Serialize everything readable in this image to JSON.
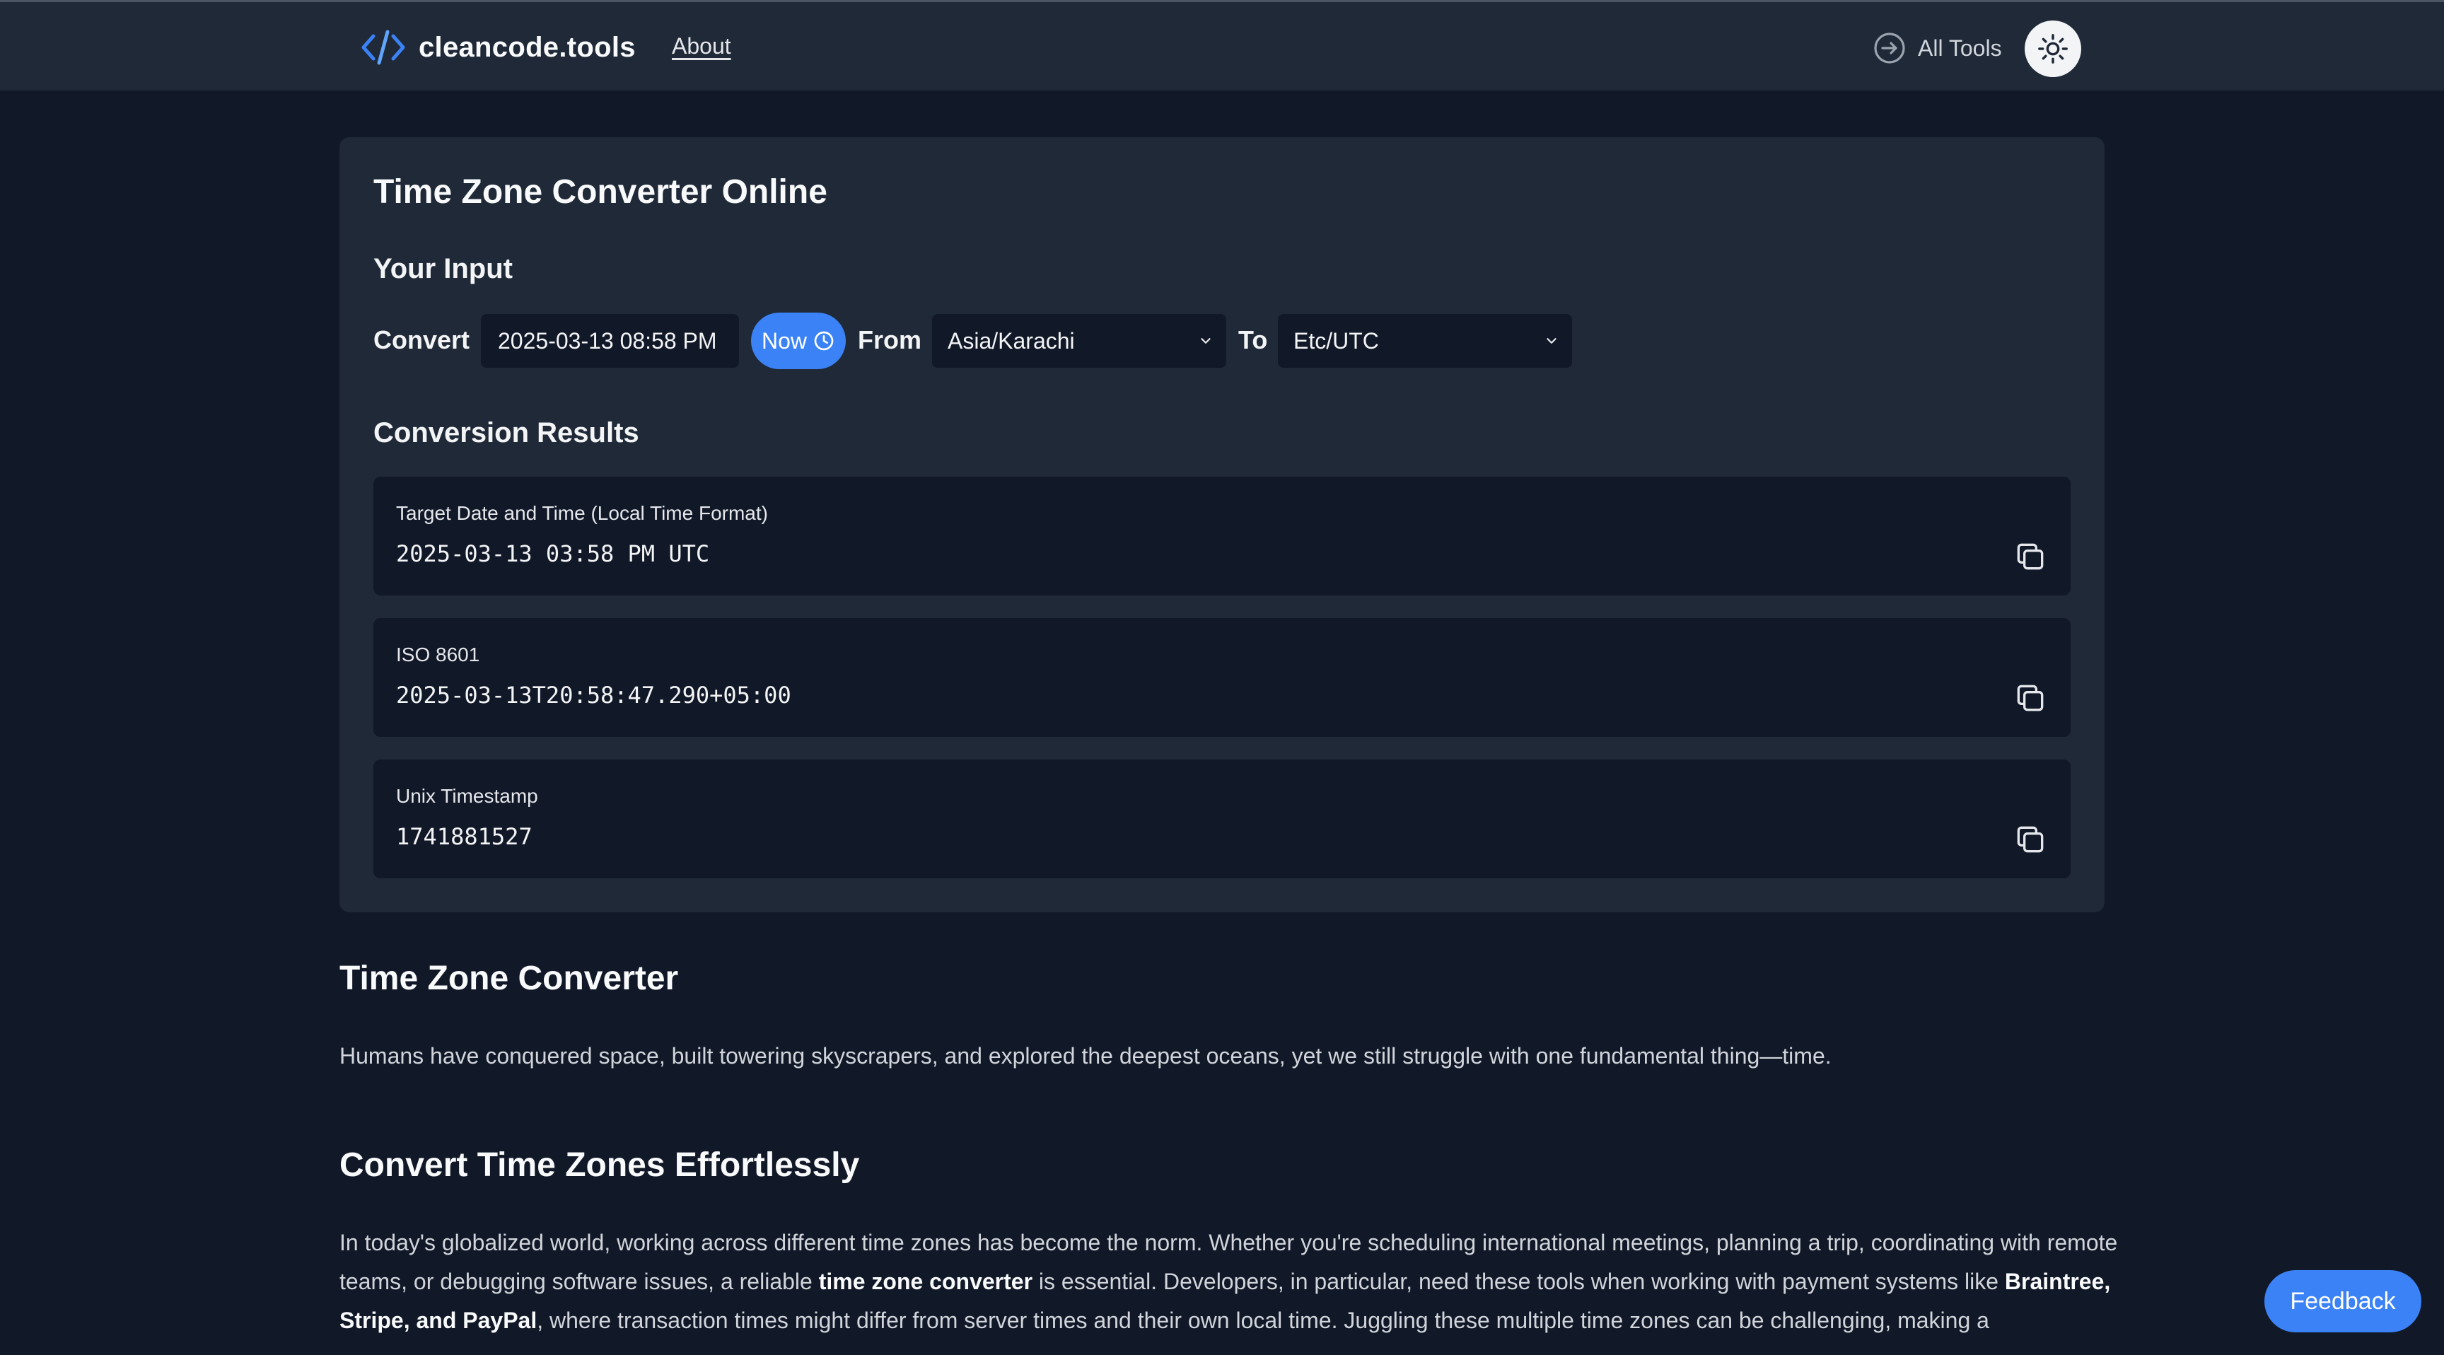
{
  "header": {
    "logo_text": "cleancode.tools",
    "about_label": "About",
    "all_tools_label": "All Tools"
  },
  "converter": {
    "title": "Time Zone Converter Online",
    "input_heading": "Your Input",
    "convert_label": "Convert",
    "datetime_value": "2025-03-13 08:58 PM",
    "now_label": "Now",
    "from_label": "From",
    "from_value": "Asia/Karachi",
    "to_label": "To",
    "to_value": "Etc/UTC",
    "results_heading": "Conversion Results",
    "results": [
      {
        "label": "Target Date and Time (Local Time Format)",
        "value": "2025-03-13 03:58 PM UTC"
      },
      {
        "label": "ISO 8601",
        "value": "2025-03-13T20:58:47.290+05:00"
      },
      {
        "label": "Unix Timestamp",
        "value": "1741881527"
      }
    ]
  },
  "article": {
    "h1": "Time Zone Converter",
    "p1": "Humans have conquered space, built towering skyscrapers, and explored the deepest oceans, yet we still struggle with one fundamental thing—time.",
    "h2": "Convert Time Zones Effortlessly",
    "p2_a": "In today's globalized world, working across different time zones has become the norm. Whether you're scheduling international meetings, planning a trip, coordinating with remote teams, or debugging software issues, a reliable ",
    "p2_b": "time zone converter",
    "p2_c": " is essential. Developers, in particular, need these tools when working with payment systems like ",
    "p2_d": "Braintree, Stripe, and PayPal",
    "p2_e": ", where transaction times might differ from server times and their own local time. Juggling these multiple time zones can be challenging, making a"
  },
  "feedback_label": "Feedback",
  "colors": {
    "background": "#111827",
    "surface": "#1f2937",
    "accent": "#3b82f6"
  }
}
